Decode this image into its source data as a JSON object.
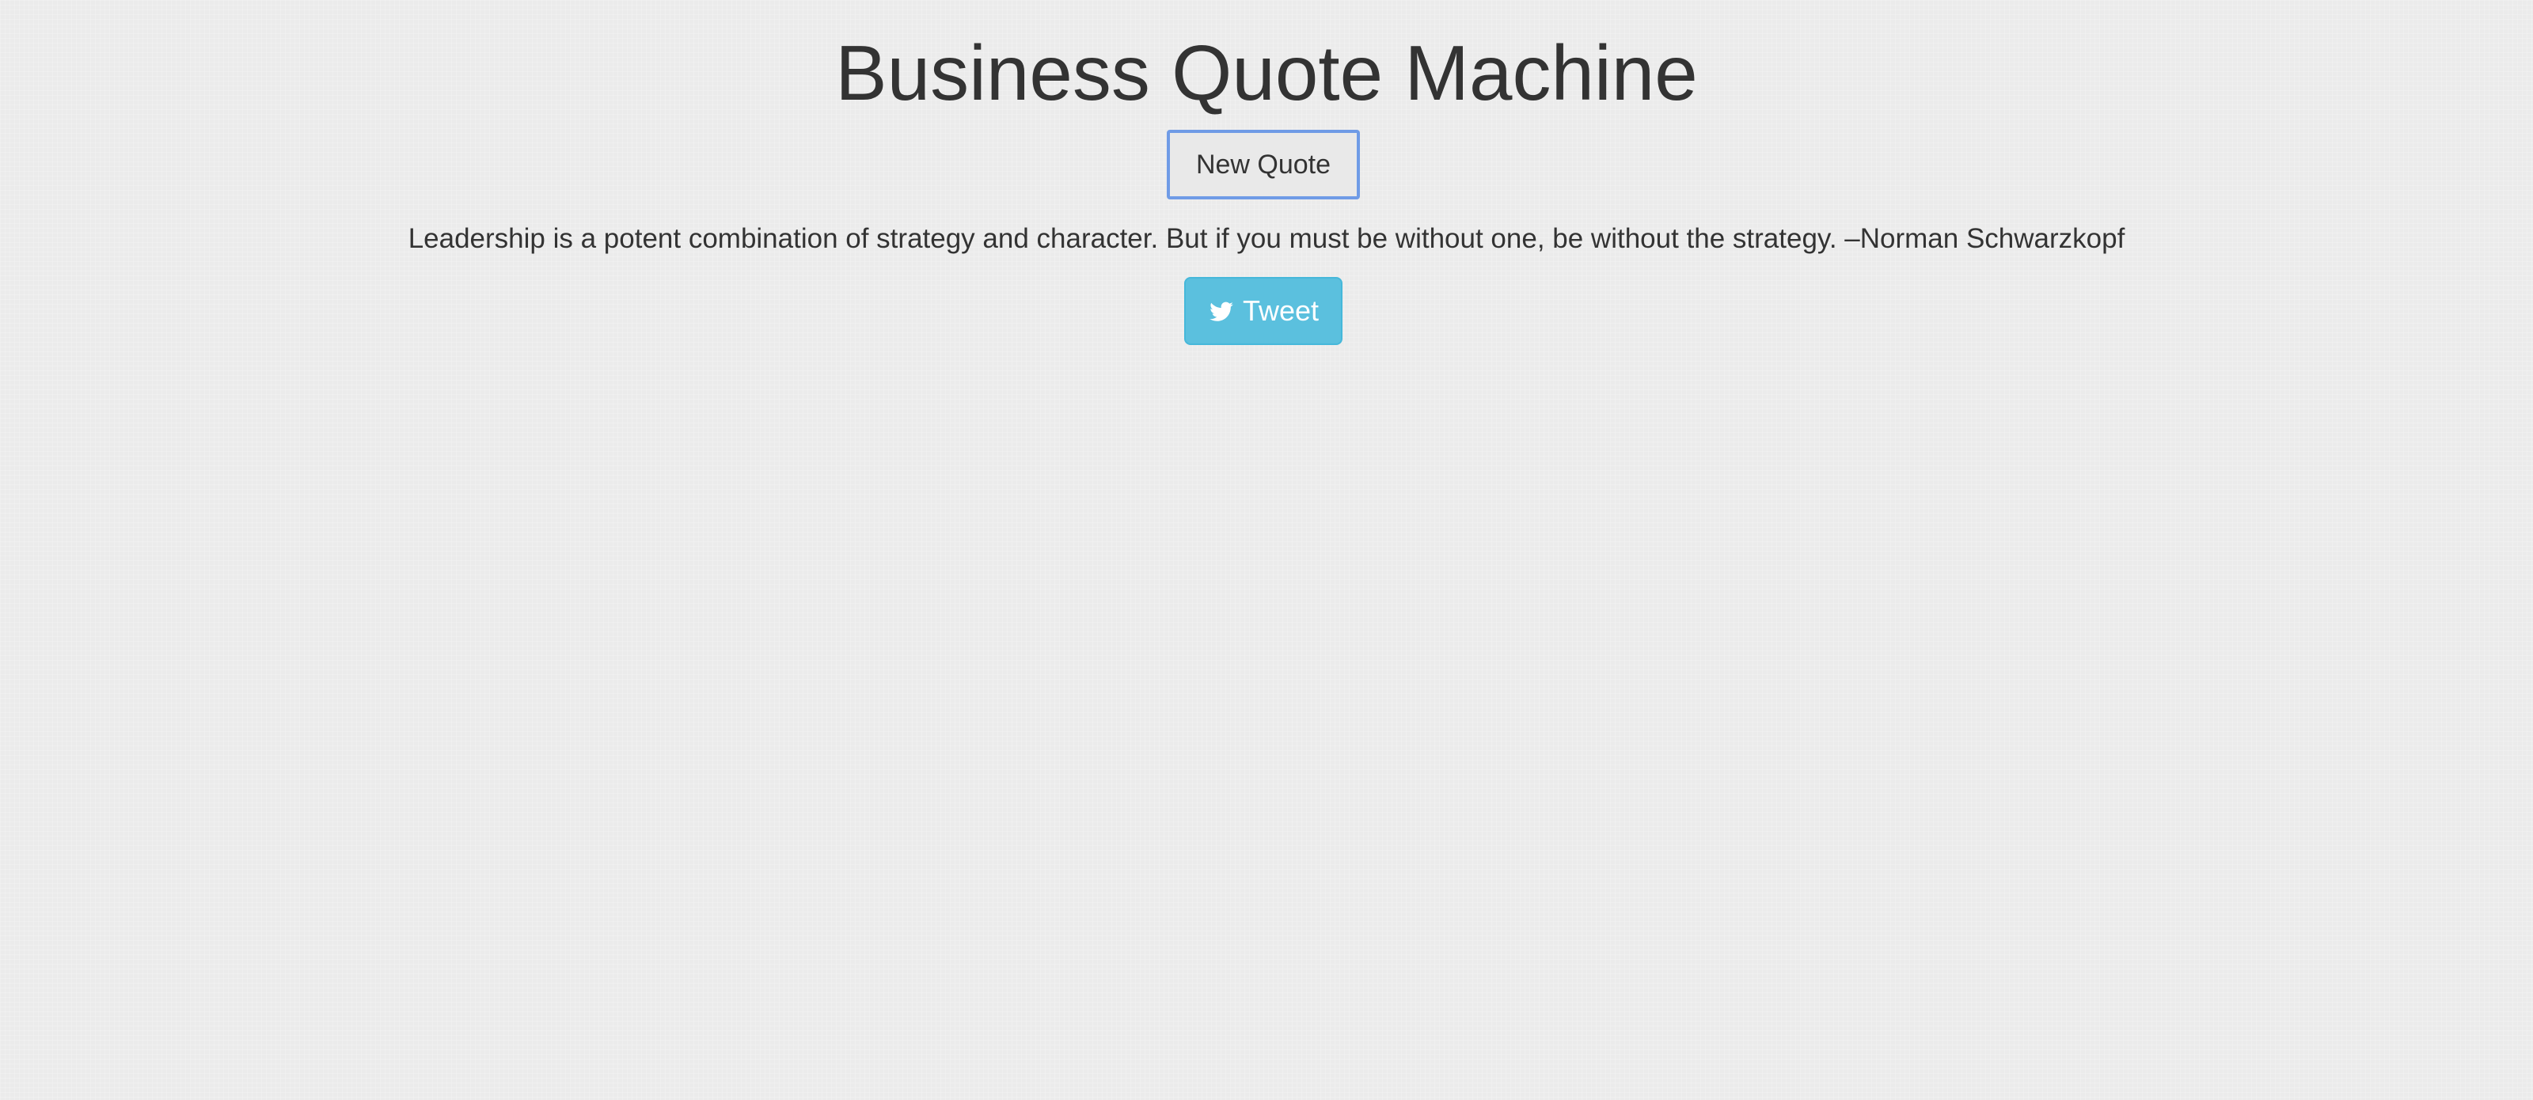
{
  "page": {
    "title": "Business Quote Machine"
  },
  "controls": {
    "new_quote_label": "New Quote",
    "tweet_label": "Tweet",
    "tweet_icon": "twitter-icon"
  },
  "quote": {
    "text": "Leadership is a potent combination of strategy and character. But if you must be without one, be without the strategy. –Norman Schwarzkopf"
  },
  "colors": {
    "background": "#ebebeb",
    "text": "#333333",
    "tweet_button": "#5bc0de",
    "focus_outline": "#6f9be6"
  }
}
